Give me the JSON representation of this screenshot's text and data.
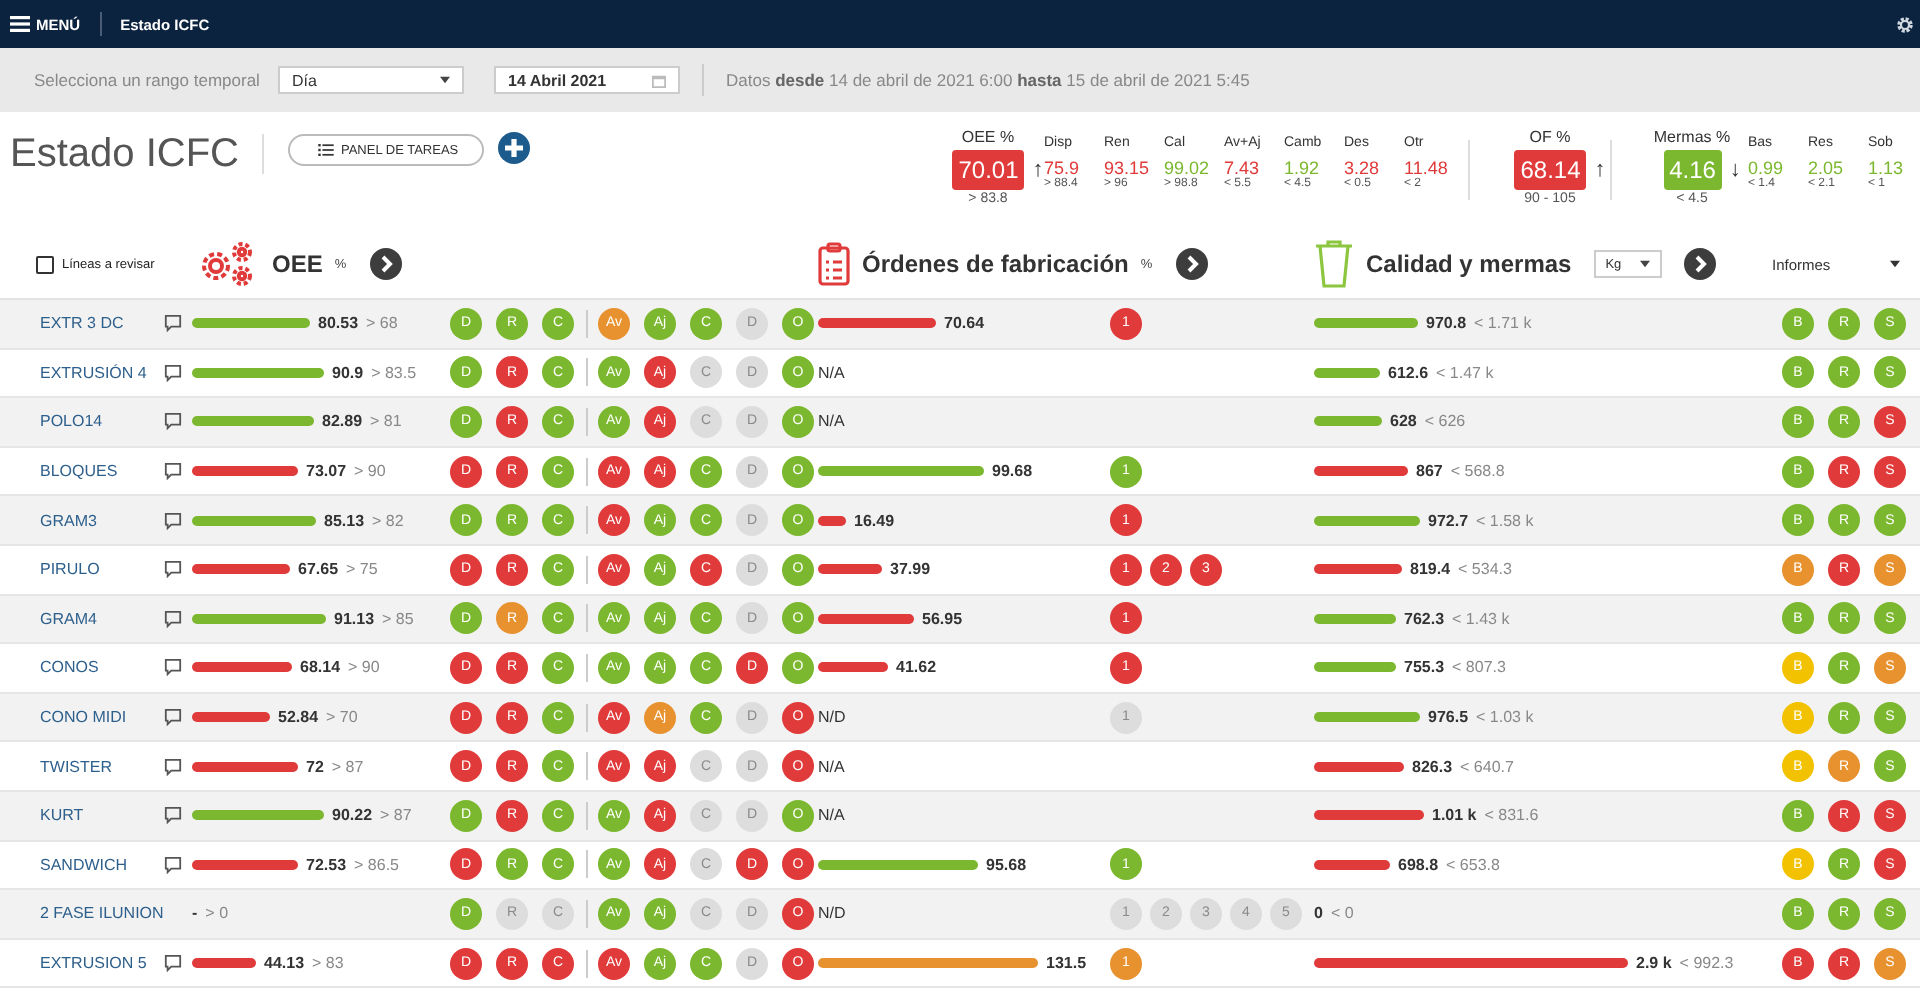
{
  "nav": {
    "menu": "MENÚ",
    "title": "Estado ICFC"
  },
  "filters": {
    "label": "Selecciona un rango temporal",
    "range": "Día",
    "date": "14 Abril 2021",
    "info": "Datos **desde** 14 de abril de 2021 6:00 **hasta** 15 de abril de 2021 5:45"
  },
  "page": {
    "title": "Estado ICFC",
    "tasks_button": "PANEL DE TAREAS"
  },
  "summary": {
    "oee": {
      "label": "OEE %",
      "value": "70.01",
      "color": "#e03a3a",
      "trend": "↑",
      "target": "> 83.8"
    },
    "oee_breakdown": [
      {
        "label": "Disp",
        "value": "75.9",
        "color": "#e03a3a",
        "target": "> 88.4"
      },
      {
        "label": "Ren",
        "value": "93.15",
        "color": "#e03a3a",
        "target": "> 96"
      },
      {
        "label": "Cal",
        "value": "99.02",
        "color": "#7cb82f",
        "target": "> 98.8"
      },
      {
        "label": "Av+Aj",
        "value": "7.43",
        "color": "#e03a3a",
        "target": "< 5.5"
      },
      {
        "label": "Camb",
        "value": "1.92",
        "color": "#7cb82f",
        "target": "< 4.5"
      },
      {
        "label": "Des",
        "value": "3.28",
        "color": "#e03a3a",
        "target": "< 0.5"
      },
      {
        "label": "Otr",
        "value": "11.48",
        "color": "#e03a3a",
        "target": "< 2"
      }
    ],
    "of": {
      "label": "OF %",
      "value": "68.14",
      "color": "#e03a3a",
      "trend": "↑",
      "target": "90 - 105"
    },
    "mermas": {
      "label": "Mermas %",
      "value": "4.16",
      "color": "#7cb82f",
      "trend": "↓",
      "target": "< 4.5"
    },
    "mermas_breakdown": [
      {
        "label": "Bas",
        "value": "0.99",
        "color": "#7cb82f",
        "target": "< 1.4"
      },
      {
        "label": "Res",
        "value": "2.05",
        "color": "#7cb82f",
        "target": "< 2.1"
      },
      {
        "label": "Sob",
        "value": "1.13",
        "color": "#7cb82f",
        "target": "< 1"
      }
    ]
  },
  "sections": {
    "review": {
      "label": "Líneas a revisar",
      "checked": false
    },
    "oee": {
      "title": "OEE",
      "unit": "%"
    },
    "orders": {
      "title": "Órdenes de fabricación",
      "unit": "%"
    },
    "quality": {
      "title": "Calidad y mermas",
      "unit": "Kg"
    },
    "reports": "Informes"
  },
  "rows": [
    {
      "name": "EXTR 3 DC",
      "comment": true,
      "oee": {
        "value": "80.53",
        "target": "> 68",
        "color": "#7cb82f"
      },
      "drc": [
        {
          "letter": "D",
          "color": "#7cb82f"
        },
        {
          "letter": "R",
          "color": "#7cb82f"
        },
        {
          "letter": "C",
          "color": "#7cb82f"
        }
      ],
      "causes": [
        {
          "letter": "Av",
          "color": "#e8922f"
        },
        {
          "letter": "Aj",
          "color": "#7cb82f"
        },
        {
          "letter": "C",
          "color": "#7cb82f"
        },
        {
          "letter": "D",
          "color": "#dddddd"
        },
        {
          "letter": "O",
          "color": "#7cb82f"
        }
      ],
      "of": {
        "value": "70.64",
        "color": "#e03a3a"
      },
      "orders": [
        {
          "label": "1",
          "color": "#e03a3a"
        }
      ],
      "merma": {
        "value": "970.8",
        "target": "< 1.71 k",
        "color": "#7cb82f"
      },
      "brs": [
        {
          "letter": "B",
          "color": "#7cb82f"
        },
        {
          "letter": "R",
          "color": "#7cb82f"
        },
        {
          "letter": "S",
          "color": "#7cb82f"
        }
      ]
    },
    {
      "name": "EXTRUSIÓN 4",
      "comment": true,
      "oee": {
        "value": "90.9",
        "target": "> 83.5",
        "color": "#7cb82f"
      },
      "drc": [
        {
          "letter": "D",
          "color": "#7cb82f"
        },
        {
          "letter": "R",
          "color": "#e03a3a"
        },
        {
          "letter": "C",
          "color": "#7cb82f"
        }
      ],
      "causes": [
        {
          "letter": "Av",
          "color": "#7cb82f"
        },
        {
          "letter": "Aj",
          "color": "#e03a3a"
        },
        {
          "letter": "C",
          "color": "#dddddd"
        },
        {
          "letter": "D",
          "color": "#dddddd"
        },
        {
          "letter": "O",
          "color": "#7cb82f"
        }
      ],
      "of": {
        "value": "N/A"
      },
      "orders": [],
      "merma": {
        "value": "612.6",
        "target": "< 1.47 k",
        "color": "#7cb82f"
      },
      "brs": [
        {
          "letter": "B",
          "color": "#7cb82f"
        },
        {
          "letter": "R",
          "color": "#7cb82f"
        },
        {
          "letter": "S",
          "color": "#7cb82f"
        }
      ]
    },
    {
      "name": "POLO14",
      "comment": true,
      "oee": {
        "value": "82.89",
        "target": "> 81",
        "color": "#7cb82f"
      },
      "drc": [
        {
          "letter": "D",
          "color": "#7cb82f"
        },
        {
          "letter": "R",
          "color": "#e03a3a"
        },
        {
          "letter": "C",
          "color": "#7cb82f"
        }
      ],
      "causes": [
        {
          "letter": "Av",
          "color": "#7cb82f"
        },
        {
          "letter": "Aj",
          "color": "#e03a3a"
        },
        {
          "letter": "C",
          "color": "#dddddd"
        },
        {
          "letter": "D",
          "color": "#dddddd"
        },
        {
          "letter": "O",
          "color": "#7cb82f"
        }
      ],
      "of": {
        "value": "N/A"
      },
      "orders": [],
      "merma": {
        "value": "628",
        "target": "< 626",
        "color": "#7cb82f"
      },
      "brs": [
        {
          "letter": "B",
          "color": "#7cb82f"
        },
        {
          "letter": "R",
          "color": "#7cb82f"
        },
        {
          "letter": "S",
          "color": "#e03a3a"
        }
      ]
    },
    {
      "name": "BLOQUES",
      "comment": true,
      "oee": {
        "value": "73.07",
        "target": "> 90",
        "color": "#e03a3a"
      },
      "drc": [
        {
          "letter": "D",
          "color": "#e03a3a"
        },
        {
          "letter": "R",
          "color": "#e03a3a"
        },
        {
          "letter": "C",
          "color": "#7cb82f"
        }
      ],
      "causes": [
        {
          "letter": "Av",
          "color": "#e03a3a"
        },
        {
          "letter": "Aj",
          "color": "#e03a3a"
        },
        {
          "letter": "C",
          "color": "#7cb82f"
        },
        {
          "letter": "D",
          "color": "#dddddd"
        },
        {
          "letter": "O",
          "color": "#7cb82f"
        }
      ],
      "of": {
        "value": "99.68",
        "color": "#7cb82f"
      },
      "orders": [
        {
          "label": "1",
          "color": "#7cb82f"
        }
      ],
      "merma": {
        "value": "867",
        "target": "< 568.8",
        "color": "#e03a3a"
      },
      "brs": [
        {
          "letter": "B",
          "color": "#7cb82f"
        },
        {
          "letter": "R",
          "color": "#e03a3a"
        },
        {
          "letter": "S",
          "color": "#e03a3a"
        }
      ]
    },
    {
      "name": "GRAM3",
      "comment": true,
      "oee": {
        "value": "85.13",
        "target": "> 82",
        "color": "#7cb82f"
      },
      "drc": [
        {
          "letter": "D",
          "color": "#7cb82f"
        },
        {
          "letter": "R",
          "color": "#7cb82f"
        },
        {
          "letter": "C",
          "color": "#7cb82f"
        }
      ],
      "causes": [
        {
          "letter": "Av",
          "color": "#e03a3a"
        },
        {
          "letter": "Aj",
          "color": "#7cb82f"
        },
        {
          "letter": "C",
          "color": "#7cb82f"
        },
        {
          "letter": "D",
          "color": "#dddddd"
        },
        {
          "letter": "O",
          "color": "#7cb82f"
        }
      ],
      "of": {
        "value": "16.49",
        "color": "#e03a3a"
      },
      "orders": [
        {
          "label": "1",
          "color": "#e03a3a"
        }
      ],
      "merma": {
        "value": "972.7",
        "target": "< 1.58 k",
        "color": "#7cb82f"
      },
      "brs": [
        {
          "letter": "B",
          "color": "#7cb82f"
        },
        {
          "letter": "R",
          "color": "#7cb82f"
        },
        {
          "letter": "S",
          "color": "#7cb82f"
        }
      ]
    },
    {
      "name": "PIRULO",
      "comment": true,
      "oee": {
        "value": "67.65",
        "target": "> 75",
        "color": "#e03a3a"
      },
      "drc": [
        {
          "letter": "D",
          "color": "#e03a3a"
        },
        {
          "letter": "R",
          "color": "#e03a3a"
        },
        {
          "letter": "C",
          "color": "#7cb82f"
        }
      ],
      "causes": [
        {
          "letter": "Av",
          "color": "#e03a3a"
        },
        {
          "letter": "Aj",
          "color": "#7cb82f"
        },
        {
          "letter": "C",
          "color": "#e03a3a"
        },
        {
          "letter": "D",
          "color": "#dddddd"
        },
        {
          "letter": "O",
          "color": "#7cb82f"
        }
      ],
      "of": {
        "value": "37.99",
        "color": "#e03a3a"
      },
      "orders": [
        {
          "label": "1",
          "color": "#e03a3a"
        },
        {
          "label": "2",
          "color": "#e03a3a"
        },
        {
          "label": "3",
          "color": "#e03a3a"
        }
      ],
      "merma": {
        "value": "819.4",
        "target": "< 534.3",
        "color": "#e03a3a"
      },
      "brs": [
        {
          "letter": "B",
          "color": "#e8922f"
        },
        {
          "letter": "R",
          "color": "#e03a3a"
        },
        {
          "letter": "S",
          "color": "#e8922f"
        }
      ]
    },
    {
      "name": "GRAM4",
      "comment": true,
      "oee": {
        "value": "91.13",
        "target": "> 85",
        "color": "#7cb82f"
      },
      "drc": [
        {
          "letter": "D",
          "color": "#7cb82f"
        },
        {
          "letter": "R",
          "color": "#e8922f"
        },
        {
          "letter": "C",
          "color": "#7cb82f"
        }
      ],
      "causes": [
        {
          "letter": "Av",
          "color": "#7cb82f"
        },
        {
          "letter": "Aj",
          "color": "#7cb82f"
        },
        {
          "letter": "C",
          "color": "#7cb82f"
        },
        {
          "letter": "D",
          "color": "#dddddd"
        },
        {
          "letter": "O",
          "color": "#7cb82f"
        }
      ],
      "of": {
        "value": "56.95",
        "color": "#e03a3a"
      },
      "orders": [
        {
          "label": "1",
          "color": "#e03a3a"
        }
      ],
      "merma": {
        "value": "762.3",
        "target": "< 1.43 k",
        "color": "#7cb82f"
      },
      "brs": [
        {
          "letter": "B",
          "color": "#7cb82f"
        },
        {
          "letter": "R",
          "color": "#7cb82f"
        },
        {
          "letter": "S",
          "color": "#7cb82f"
        }
      ]
    },
    {
      "name": "CONOS",
      "comment": true,
      "oee": {
        "value": "68.14",
        "target": "> 90",
        "color": "#e03a3a"
      },
      "drc": [
        {
          "letter": "D",
          "color": "#e03a3a"
        },
        {
          "letter": "R",
          "color": "#e03a3a"
        },
        {
          "letter": "C",
          "color": "#7cb82f"
        }
      ],
      "causes": [
        {
          "letter": "Av",
          "color": "#7cb82f"
        },
        {
          "letter": "Aj",
          "color": "#7cb82f"
        },
        {
          "letter": "C",
          "color": "#7cb82f"
        },
        {
          "letter": "D",
          "color": "#e03a3a"
        },
        {
          "letter": "O",
          "color": "#7cb82f"
        }
      ],
      "of": {
        "value": "41.62",
        "color": "#e03a3a"
      },
      "orders": [
        {
          "label": "1",
          "color": "#e03a3a"
        }
      ],
      "merma": {
        "value": "755.3",
        "target": "< 807.3",
        "color": "#7cb82f"
      },
      "brs": [
        {
          "letter": "B",
          "color": "#f2c200"
        },
        {
          "letter": "R",
          "color": "#7cb82f"
        },
        {
          "letter": "S",
          "color": "#e8922f"
        }
      ]
    },
    {
      "name": "CONO MIDI",
      "comment": true,
      "oee": {
        "value": "52.84",
        "target": "> 70",
        "color": "#e03a3a"
      },
      "drc": [
        {
          "letter": "D",
          "color": "#e03a3a"
        },
        {
          "letter": "R",
          "color": "#e03a3a"
        },
        {
          "letter": "C",
          "color": "#7cb82f"
        }
      ],
      "causes": [
        {
          "letter": "Av",
          "color": "#e03a3a"
        },
        {
          "letter": "Aj",
          "color": "#e8922f"
        },
        {
          "letter": "C",
          "color": "#7cb82f"
        },
        {
          "letter": "D",
          "color": "#dddddd"
        },
        {
          "letter": "O",
          "color": "#e03a3a"
        }
      ],
      "of": {
        "value": "N/D"
      },
      "orders": [
        {
          "label": "1",
          "color": "#dddddd"
        }
      ],
      "merma": {
        "value": "976.5",
        "target": "< 1.03 k",
        "color": "#7cb82f"
      },
      "brs": [
        {
          "letter": "B",
          "color": "#f2c200"
        },
        {
          "letter": "R",
          "color": "#7cb82f"
        },
        {
          "letter": "S",
          "color": "#7cb82f"
        }
      ]
    },
    {
      "name": "TWISTER",
      "comment": true,
      "oee": {
        "value": "72",
        "target": "> 87",
        "color": "#e03a3a"
      },
      "drc": [
        {
          "letter": "D",
          "color": "#e03a3a"
        },
        {
          "letter": "R",
          "color": "#e03a3a"
        },
        {
          "letter": "C",
          "color": "#7cb82f"
        }
      ],
      "causes": [
        {
          "letter": "Av",
          "color": "#e03a3a"
        },
        {
          "letter": "Aj",
          "color": "#e03a3a"
        },
        {
          "letter": "C",
          "color": "#dddddd"
        },
        {
          "letter": "D",
          "color": "#dddddd"
        },
        {
          "letter": "O",
          "color": "#e03a3a"
        }
      ],
      "of": {
        "value": "N/A"
      },
      "orders": [],
      "merma": {
        "value": "826.3",
        "target": "< 640.7",
        "color": "#e03a3a"
      },
      "brs": [
        {
          "letter": "B",
          "color": "#f2c200"
        },
        {
          "letter": "R",
          "color": "#e8922f"
        },
        {
          "letter": "S",
          "color": "#7cb82f"
        }
      ]
    },
    {
      "name": "KURT",
      "comment": true,
      "oee": {
        "value": "90.22",
        "target": "> 87",
        "color": "#7cb82f"
      },
      "drc": [
        {
          "letter": "D",
          "color": "#7cb82f"
        },
        {
          "letter": "R",
          "color": "#e03a3a"
        },
        {
          "letter": "C",
          "color": "#7cb82f"
        }
      ],
      "causes": [
        {
          "letter": "Av",
          "color": "#7cb82f"
        },
        {
          "letter": "Aj",
          "color": "#e03a3a"
        },
        {
          "letter": "C",
          "color": "#dddddd"
        },
        {
          "letter": "D",
          "color": "#dddddd"
        },
        {
          "letter": "O",
          "color": "#7cb82f"
        }
      ],
      "of": {
        "value": "N/A"
      },
      "orders": [],
      "merma": {
        "value": "1.01 k",
        "target": "< 831.6",
        "color": "#e03a3a"
      },
      "brs": [
        {
          "letter": "B",
          "color": "#7cb82f"
        },
        {
          "letter": "R",
          "color": "#e03a3a"
        },
        {
          "letter": "S",
          "color": "#e03a3a"
        }
      ]
    },
    {
      "name": "SANDWICH",
      "comment": true,
      "oee": {
        "value": "72.53",
        "target": "> 86.5",
        "color": "#e03a3a"
      },
      "drc": [
        {
          "letter": "D",
          "color": "#e03a3a"
        },
        {
          "letter": "R",
          "color": "#7cb82f"
        },
        {
          "letter": "C",
          "color": "#7cb82f"
        }
      ],
      "causes": [
        {
          "letter": "Av",
          "color": "#7cb82f"
        },
        {
          "letter": "Aj",
          "color": "#e03a3a"
        },
        {
          "letter": "C",
          "color": "#dddddd"
        },
        {
          "letter": "D",
          "color": "#e03a3a"
        },
        {
          "letter": "O",
          "color": "#e03a3a"
        }
      ],
      "of": {
        "value": "95.68",
        "color": "#7cb82f"
      },
      "orders": [
        {
          "label": "1",
          "color": "#7cb82f"
        }
      ],
      "merma": {
        "value": "698.8",
        "target": "< 653.8",
        "color": "#e03a3a"
      },
      "brs": [
        {
          "letter": "B",
          "color": "#f2c200"
        },
        {
          "letter": "R",
          "color": "#7cb82f"
        },
        {
          "letter": "S",
          "color": "#e03a3a"
        }
      ]
    },
    {
      "name": "2 FASE ILUNION",
      "comment": false,
      "oee": {
        "value": "-",
        "target": "> 0"
      },
      "drc": [
        {
          "letter": "D",
          "color": "#7cb82f"
        },
        {
          "letter": "R",
          "color": "#dddddd"
        },
        {
          "letter": "C",
          "color": "#dddddd"
        }
      ],
      "causes": [
        {
          "letter": "Av",
          "color": "#7cb82f"
        },
        {
          "letter": "Aj",
          "color": "#7cb82f"
        },
        {
          "letter": "C",
          "color": "#dddddd"
        },
        {
          "letter": "D",
          "color": "#dddddd"
        },
        {
          "letter": "O",
          "color": "#e03a3a"
        }
      ],
      "of": {
        "value": "N/D"
      },
      "orders": [
        {
          "label": "1",
          "color": "#dddddd"
        },
        {
          "label": "2",
          "color": "#dddddd"
        },
        {
          "label": "3",
          "color": "#dddddd"
        },
        {
          "label": "4",
          "color": "#dddddd"
        },
        {
          "label": "5",
          "color": "#dddddd"
        }
      ],
      "merma": {
        "value": "0",
        "target": "< 0"
      },
      "brs": [
        {
          "letter": "B",
          "color": "#7cb82f"
        },
        {
          "letter": "R",
          "color": "#7cb82f"
        },
        {
          "letter": "S",
          "color": "#7cb82f"
        }
      ]
    },
    {
      "name": "EXTRUSION 5",
      "comment": true,
      "oee": {
        "value": "44.13",
        "target": "> 83",
        "color": "#e03a3a"
      },
      "drc": [
        {
          "letter": "D",
          "color": "#e03a3a"
        },
        {
          "letter": "R",
          "color": "#e03a3a"
        },
        {
          "letter": "C",
          "color": "#e03a3a"
        }
      ],
      "causes": [
        {
          "letter": "Av",
          "color": "#e03a3a"
        },
        {
          "letter": "Aj",
          "color": "#7cb82f"
        },
        {
          "letter": "C",
          "color": "#7cb82f"
        },
        {
          "letter": "D",
          "color": "#dddddd"
        },
        {
          "letter": "O",
          "color": "#e03a3a"
        }
      ],
      "of": {
        "value": "131.5",
        "color": "#e8922f"
      },
      "orders": [
        {
          "label": "1",
          "color": "#e8922f"
        }
      ],
      "merma": {
        "value": "2.9 k",
        "target": "< 992.3",
        "color": "#e03a3a"
      },
      "brs": [
        {
          "letter": "B",
          "color": "#e03a3a"
        },
        {
          "letter": "R",
          "color": "#e03a3a"
        },
        {
          "letter": "S",
          "color": "#e8922f"
        }
      ]
    }
  ]
}
